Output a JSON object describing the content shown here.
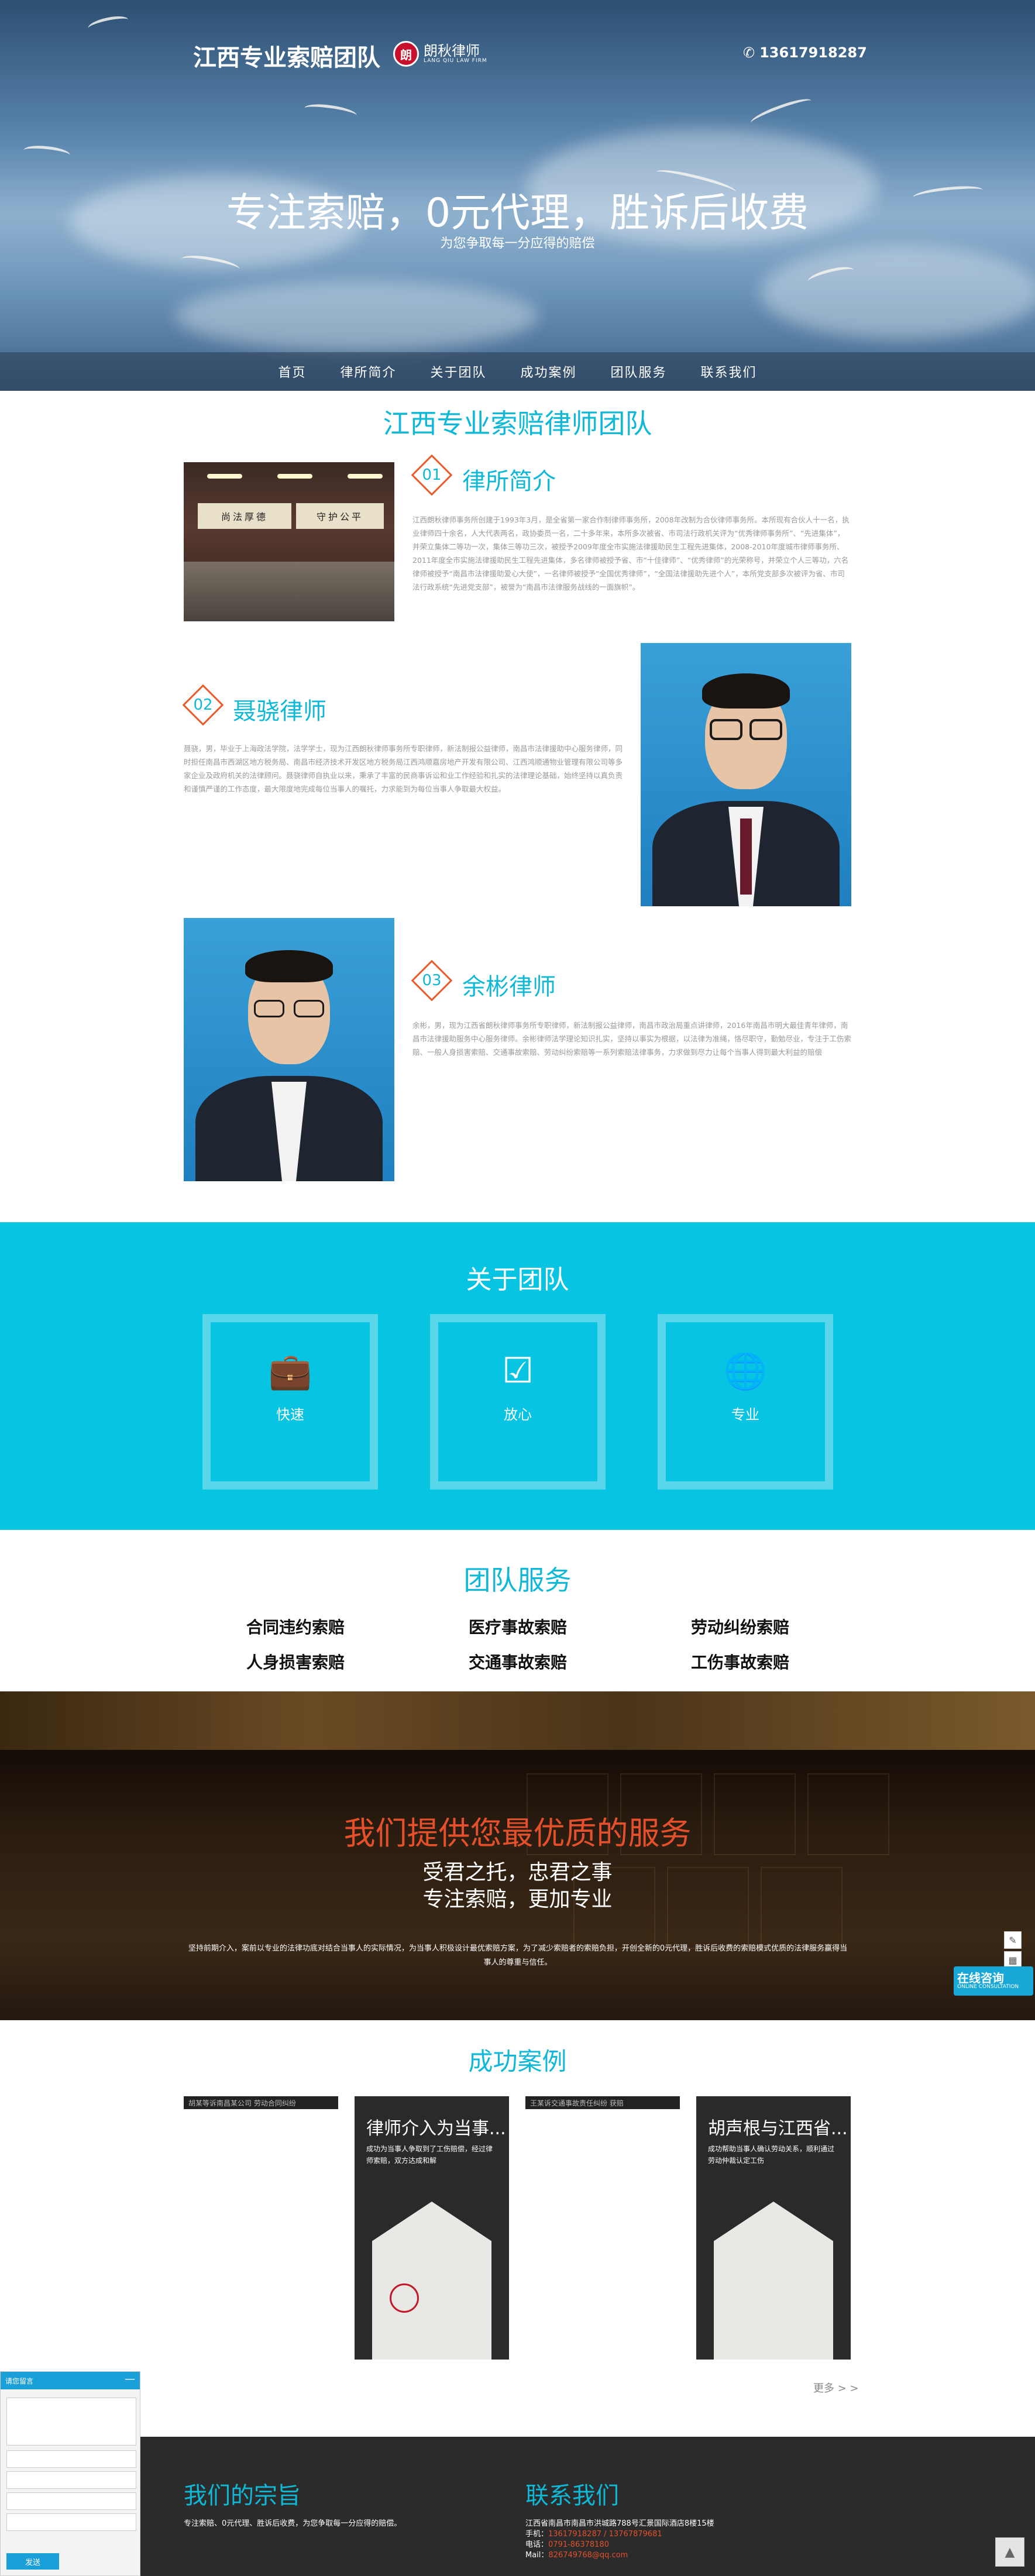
{
  "header": {
    "brand": "江西专业索赔团队",
    "logo_name": "朗秋律师",
    "logo_sub": "LANG QIU LAW FIRM",
    "phone": "13617918287"
  },
  "hero": {
    "title": "专注索赔，0元代理，胜诉后收费",
    "subtitle": "为您争取每一分应得的赔偿"
  },
  "nav": [
    "首页",
    "律所简介",
    "关于团队",
    "成功案例",
    "团队服务",
    "联系我们"
  ],
  "intro": {
    "title": "江西专业索赔律师团队",
    "office_sign_1": "尚法厚德",
    "office_sign_2": "守护公平",
    "blocks": [
      {
        "num": "01",
        "title": "律所简介",
        "text": "江西朗秋律师事务所创建于1993年3月，是全省第一家合作制律师事务所，2008年改制为合伙律师事务所。本所现有合伙人十一名，执业律师四十余名，人大代表两名，政协委员一名，二十多年来，本所多次被省、市司法行政机关评为“优秀律师事务所”、“先进集体”，并荣立集体二等功一次，集体三等功三次，被授予2009年度全市实施法律援助民生工程先进集体，2008-2010年度城市律师事务所、2011年度全市实施法律援助民生工程先进集体，多名律师被授予省、市“十佳律师”、“优秀律师”的光荣称号，并荣立个人三等功，六名律师被授予“南昌市法律援助爱心大使”，一名律师被授予“全国优秀律师”，“全国法律援助先进个人”，本所党支部多次被评为省、市司法行政系统“先进党支部”，被誉为“南昌市法律服务战线的一面旗帜”。"
      },
      {
        "num": "02",
        "title": "聂骁律师",
        "text": "聂骁，男，毕业于上海政法学院，法学学士，现为江西朗秋律师事务所专职律师，新法制报公益律师，南昌市法律援助中心服务律师，同时担任南昌市西湖区地方税务局、南昌市经济技术开发区地方税务局江西鸿顺嘉房地产开发有限公司、江西鸿顺通物业管理有限公司等多家企业及政府机关的法律顾问。聂骁律师自执业以来，秉承了丰富的民商事诉讼和业工作经验和扎实的法律理论基础，始终坚持以真负责和谨慎严谨的工作态度，最大限度地完成每位当事人的嘱托，力求能到为每位当事人争取最大权益。"
      },
      {
        "num": "03",
        "title": "余彬律师",
        "text": "余彬，男，现为江西省朗秋律师事务所专职律师，新法制报公益律师，南昌市政治局重点讲律师，2016年南昌市明大最佳青年律师，南昌市法律援助服务中心服务律师。余彬律师法学理论知识扎实，坚持以事实为根据，以法律为准绳，恪尽职守，勤勉尽业，专注于工伤索赔、一般人身损害索赔、交通事故索赔、劳动纠纷索赔等一系列索赔法律事务，力求做到尽力让每个当事人得到最大利益的赔偿"
      }
    ]
  },
  "team": {
    "title": "关于团队",
    "cards": [
      {
        "icon": "briefcase-icon",
        "label": "快速"
      },
      {
        "icon": "check-icon",
        "label": "放心"
      },
      {
        "icon": "globe-icon",
        "label": "专业"
      }
    ]
  },
  "services": {
    "title": "团队服务",
    "items": [
      "合同违约索赔",
      "医疗事故索赔",
      "劳动纠纷索赔",
      "人身损害索赔",
      "交通事故索赔",
      "工伤事故索赔"
    ]
  },
  "promo": {
    "headline": "我们提供您最优质的服务",
    "line1": "受君之托，忠君之事",
    "line2": "专注索赔，更加专业",
    "desc": "坚持前期介入，案前以专业的法律功底对结合当事人的实际情况，为当事人积极设计最优索赔方案，为了减少索赔者的索赔负担，开创全新的0元代理，胜诉后收费的索赔模式优质的法律服务赢得当事人的尊重与信任。"
  },
  "side": {
    "online_title": "在线咨询",
    "online_sub": "ONLINE CONSULTATION"
  },
  "cases": {
    "title": "成功案例",
    "thin_1": "胡某等诉南昌某公司 劳动合同纠纷",
    "thin_2": "王某诉交通事故责任纠纷 获赔",
    "items": [
      {
        "title": "律师介入为当事...",
        "desc": "成功为当事人争取到了工伤赔偿，经过律师索赔，双方达成和解"
      },
      {
        "title": "胡声根与江西省...",
        "desc": "成功帮助当事人确认劳动关系，顺利通过劳动仲裁认定工伤"
      }
    ],
    "more": "更多 > >"
  },
  "footer": {
    "mission_title": "我们的宗旨",
    "mission_text": "专注索赔、0元代理、胜诉后收费，为您争取每一分应得的赔偿。",
    "contact_title": "联系我们",
    "address": "江西省南昌市南昌市洪城路788号汇景国际酒店8楼15楼",
    "mobile_label": "手机：",
    "mobile": "13617918287 / 13767879681",
    "tel_label": "电话：",
    "tel": "0791-86378180",
    "mail_label": "Mail：",
    "mail": "826749768@qq.com"
  },
  "chat": {
    "title": "请您留言",
    "close": "—",
    "send": "发送"
  }
}
